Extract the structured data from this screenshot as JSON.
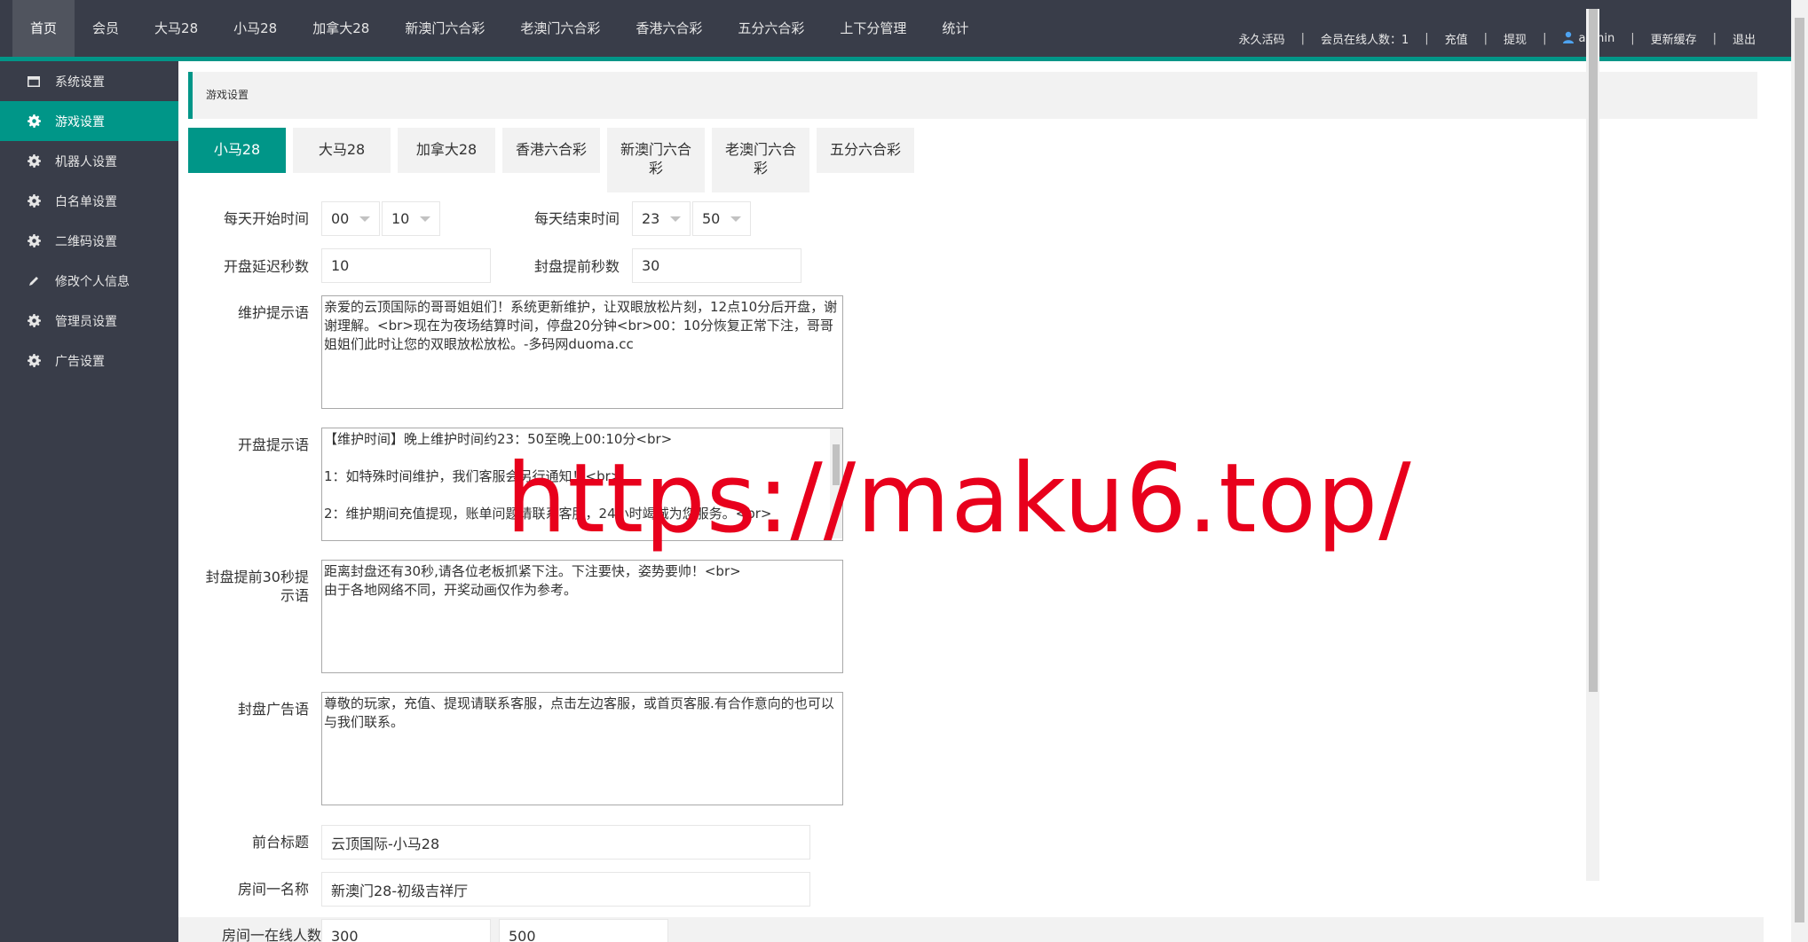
{
  "colors": {
    "topbar": "#393d49",
    "accent": "#009688",
    "panel": "#f2f2f2",
    "watermark": "#e8001c"
  },
  "nav": {
    "items": [
      "首页",
      "会员",
      "大马28",
      "小马28",
      "加拿大28",
      "新澳门六合彩",
      "老澳门六合彩",
      "香港六合彩",
      "五分六合彩",
      "上下分管理",
      "统计"
    ]
  },
  "topright": {
    "activation": "永久活码",
    "online": "会员在线人数：1",
    "recharge": "充值",
    "withdraw": "提现",
    "user": "admin",
    "user_icon": "user-icon",
    "refresh_cache": "更新缓存",
    "logout": "退出"
  },
  "sidebar": {
    "items": [
      {
        "label": "系统设置",
        "icon": "window-icon"
      },
      {
        "label": "游戏设置",
        "icon": "gear-icon"
      },
      {
        "label": "机器人设置",
        "icon": "gear-icon"
      },
      {
        "label": "白名单设置",
        "icon": "gear-icon"
      },
      {
        "label": "二维码设置",
        "icon": "gear-icon"
      },
      {
        "label": "修改个人信息",
        "icon": "pencil-icon"
      },
      {
        "label": "管理员设置",
        "icon": "gear-icon"
      },
      {
        "label": "广告设置",
        "icon": "gear-icon"
      }
    ]
  },
  "breadcrumb": "游戏设置",
  "tabs": [
    "小马28",
    "大马28",
    "加拿大28",
    "香港六合彩",
    "新澳门六合彩",
    "老澳门六合彩",
    "五分六合彩"
  ],
  "form": {
    "start_time_label": "每天开始时间",
    "start_hour": "00",
    "start_minute": "10",
    "end_time_label": "每天结束时间",
    "end_hour": "23",
    "end_minute": "50",
    "open_delay_label": "开盘延迟秒数",
    "open_delay": "10",
    "close_ahead_label": "封盘提前秒数",
    "close_ahead": "30",
    "maintenance_label": "维护提示语",
    "maintenance_text": "亲爱的云顶国际的哥哥姐姐们！系统更新维护，让双眼放松片刻，12点10分后开盘，谢谢理解。<br>现在为夜场结算时间，停盘20分钟<br>00：10分恢复正常下注，哥哥姐姐们此时让您的双眼放松放松。-多码网duoma.cc",
    "open_tip_label": "开盘提示语",
    "open_tip_text": "【维护时间】晚上维护时间约23：50至晚上00:10分<br>\n\n1：如特殊时间维护，我们客服会另行通知！<br>\n\n2：维护期间充值提现，账单问题请联系客服，24小时竭诚为您服务。<br>",
    "close30_label": "封盘提前30秒提示语",
    "close30_text": "距离封盘还有30秒,请各位老板抓紧下注。下注要快，姿势要帅！<br>\n由于各地网络不同，开奖动画仅作为参考。",
    "close_ad_label": "封盘广告语",
    "close_ad_text": "尊敬的玩家，充值、提现请联系客服，点击左边客服，或首页客服.有合作意向的也可以与我们联系。",
    "front_title_label": "前台标题",
    "front_title": "云顶国际-小马28",
    "room1_name_label": "房间一名称",
    "room1_name": "新澳门28-初级吉祥厅",
    "room1_online_label": "房间一在线人数",
    "room1_online_min": "300",
    "room1_online_max": "500"
  },
  "watermark": "https://maku6.top/"
}
